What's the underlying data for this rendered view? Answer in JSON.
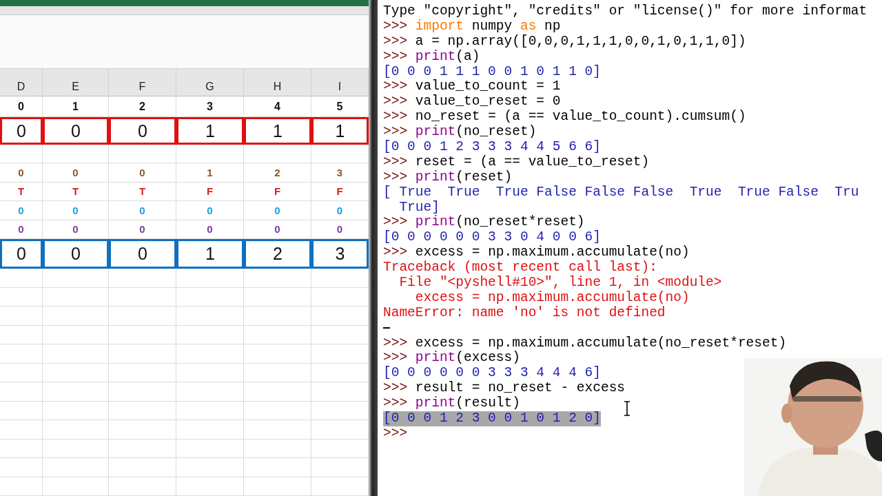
{
  "spreadsheet": {
    "columns": [
      "D",
      "E",
      "F",
      "G",
      "H",
      "I"
    ],
    "rows": [
      {
        "kind": "index",
        "cells": [
          "0",
          "1",
          "2",
          "3",
          "4",
          "5"
        ]
      },
      {
        "kind": "boxed",
        "color": "#e01010",
        "cells": [
          "0",
          "0",
          "0",
          "1",
          "1",
          "1"
        ]
      },
      {
        "kind": "blank"
      },
      {
        "kind": "small",
        "color": "#8a5a24",
        "cells": [
          "0",
          "0",
          "0",
          "1",
          "2",
          "3"
        ]
      },
      {
        "kind": "small",
        "color": "#d42020",
        "cells": [
          "T",
          "T",
          "T",
          "F",
          "F",
          "F"
        ]
      },
      {
        "kind": "small",
        "color": "#1aa0d8",
        "cells": [
          "0",
          "0",
          "0",
          "0",
          "0",
          "0"
        ]
      },
      {
        "kind": "small",
        "color": "#7a3a9a",
        "cells": [
          "0",
          "0",
          "0",
          "0",
          "0",
          "0"
        ]
      },
      {
        "kind": "boxed",
        "color": "#1070c0",
        "cells": [
          "0",
          "0",
          "0",
          "1",
          "2",
          "3"
        ]
      }
    ]
  },
  "shell": {
    "lines": [
      {
        "kind": "output",
        "parts": [
          {
            "kind": "plain",
            "text": "Type \"copyright\", \"credits\" or \"license()\" for more informat"
          }
        ]
      },
      {
        "kind": "input",
        "parts": [
          {
            "kind": "keyword",
            "text": "import"
          },
          {
            "kind": "plain",
            "text": " numpy "
          },
          {
            "kind": "keyword",
            "text": "as"
          },
          {
            "kind": "plain",
            "text": " np"
          }
        ]
      },
      {
        "kind": "input",
        "parts": [
          {
            "kind": "plain",
            "text": "a = np.array([0,0,0,1,1,1,0,0,1,0,1,1,0])"
          }
        ]
      },
      {
        "kind": "input",
        "parts": [
          {
            "kind": "builtin",
            "text": "print"
          },
          {
            "kind": "plain",
            "text": "(a)"
          }
        ]
      },
      {
        "kind": "result",
        "selected": false,
        "parts": [
          {
            "kind": "plain",
            "text": "[0 0 0 1 1 1 0 0 1 0 1 1 0]"
          }
        ]
      },
      {
        "kind": "input",
        "parts": [
          {
            "kind": "plain",
            "text": "value_to_count = 1"
          }
        ]
      },
      {
        "kind": "input",
        "parts": [
          {
            "kind": "plain",
            "text": "value_to_reset = 0"
          }
        ]
      },
      {
        "kind": "input",
        "parts": [
          {
            "kind": "plain",
            "text": "no_reset = (a == value_to_count).cumsum()"
          }
        ]
      },
      {
        "kind": "input",
        "parts": [
          {
            "kind": "builtin",
            "text": "print"
          },
          {
            "kind": "plain",
            "text": "(no_reset)"
          }
        ]
      },
      {
        "kind": "result",
        "selected": false,
        "parts": [
          {
            "kind": "plain",
            "text": "[0 0 0 1 2 3 3 3 4 4 5 6 6]"
          }
        ]
      },
      {
        "kind": "input",
        "parts": [
          {
            "kind": "plain",
            "text": "reset = (a == value_to_reset)"
          }
        ]
      },
      {
        "kind": "input",
        "parts": [
          {
            "kind": "builtin",
            "text": "print"
          },
          {
            "kind": "plain",
            "text": "(reset)"
          }
        ]
      },
      {
        "kind": "result",
        "selected": false,
        "parts": [
          {
            "kind": "plain",
            "text": "[ True  True  True False False False  True  True False  Tru"
          }
        ]
      },
      {
        "kind": "result",
        "selected": false,
        "parts": [
          {
            "kind": "plain",
            "text": "  True]"
          }
        ]
      },
      {
        "kind": "input",
        "parts": [
          {
            "kind": "builtin",
            "text": "print"
          },
          {
            "kind": "plain",
            "text": "(no_reset*reset)"
          }
        ]
      },
      {
        "kind": "result",
        "selected": false,
        "parts": [
          {
            "kind": "plain",
            "text": "[0 0 0 0 0 0 3 3 0 4 0 0 6]"
          }
        ]
      },
      {
        "kind": "input",
        "parts": [
          {
            "kind": "plain",
            "text": "excess = np.maximum.accumulate(no)"
          }
        ]
      },
      {
        "kind": "error",
        "parts": [
          {
            "kind": "plain",
            "text": "Traceback (most recent call last):"
          }
        ]
      },
      {
        "kind": "error",
        "parts": [
          {
            "kind": "plain",
            "text": "  File \"<pyshell#10>\", line 1, in <module>"
          }
        ]
      },
      {
        "kind": "error",
        "parts": [
          {
            "kind": "plain",
            "text": "    excess = np.maximum.accumulate(no)"
          }
        ]
      },
      {
        "kind": "error",
        "parts": [
          {
            "kind": "plain",
            "text": "NameError: name 'no' is not defined"
          }
        ]
      },
      {
        "kind": "cursor"
      },
      {
        "kind": "input",
        "parts": [
          {
            "kind": "plain",
            "text": "excess = np.maximum.accumulate(no_reset*reset)"
          }
        ]
      },
      {
        "kind": "input",
        "parts": [
          {
            "kind": "builtin",
            "text": "print"
          },
          {
            "kind": "plain",
            "text": "(excess)"
          }
        ]
      },
      {
        "kind": "result",
        "selected": false,
        "parts": [
          {
            "kind": "plain",
            "text": "[0 0 0 0 0 0 3 3 3 4 4 4 6]"
          }
        ]
      },
      {
        "kind": "input",
        "parts": [
          {
            "kind": "plain",
            "text": "result = no_reset - excess"
          }
        ]
      },
      {
        "kind": "input",
        "parts": [
          {
            "kind": "builtin",
            "text": "print"
          },
          {
            "kind": "plain",
            "text": "(result)"
          }
        ]
      },
      {
        "kind": "result",
        "selected": true,
        "parts": [
          {
            "kind": "plain",
            "text": "[0 0 0 1 2 3 0 0 1 0 1 2 0]"
          }
        ]
      },
      {
        "kind": "prompt"
      }
    ],
    "prompt": ">>>"
  }
}
